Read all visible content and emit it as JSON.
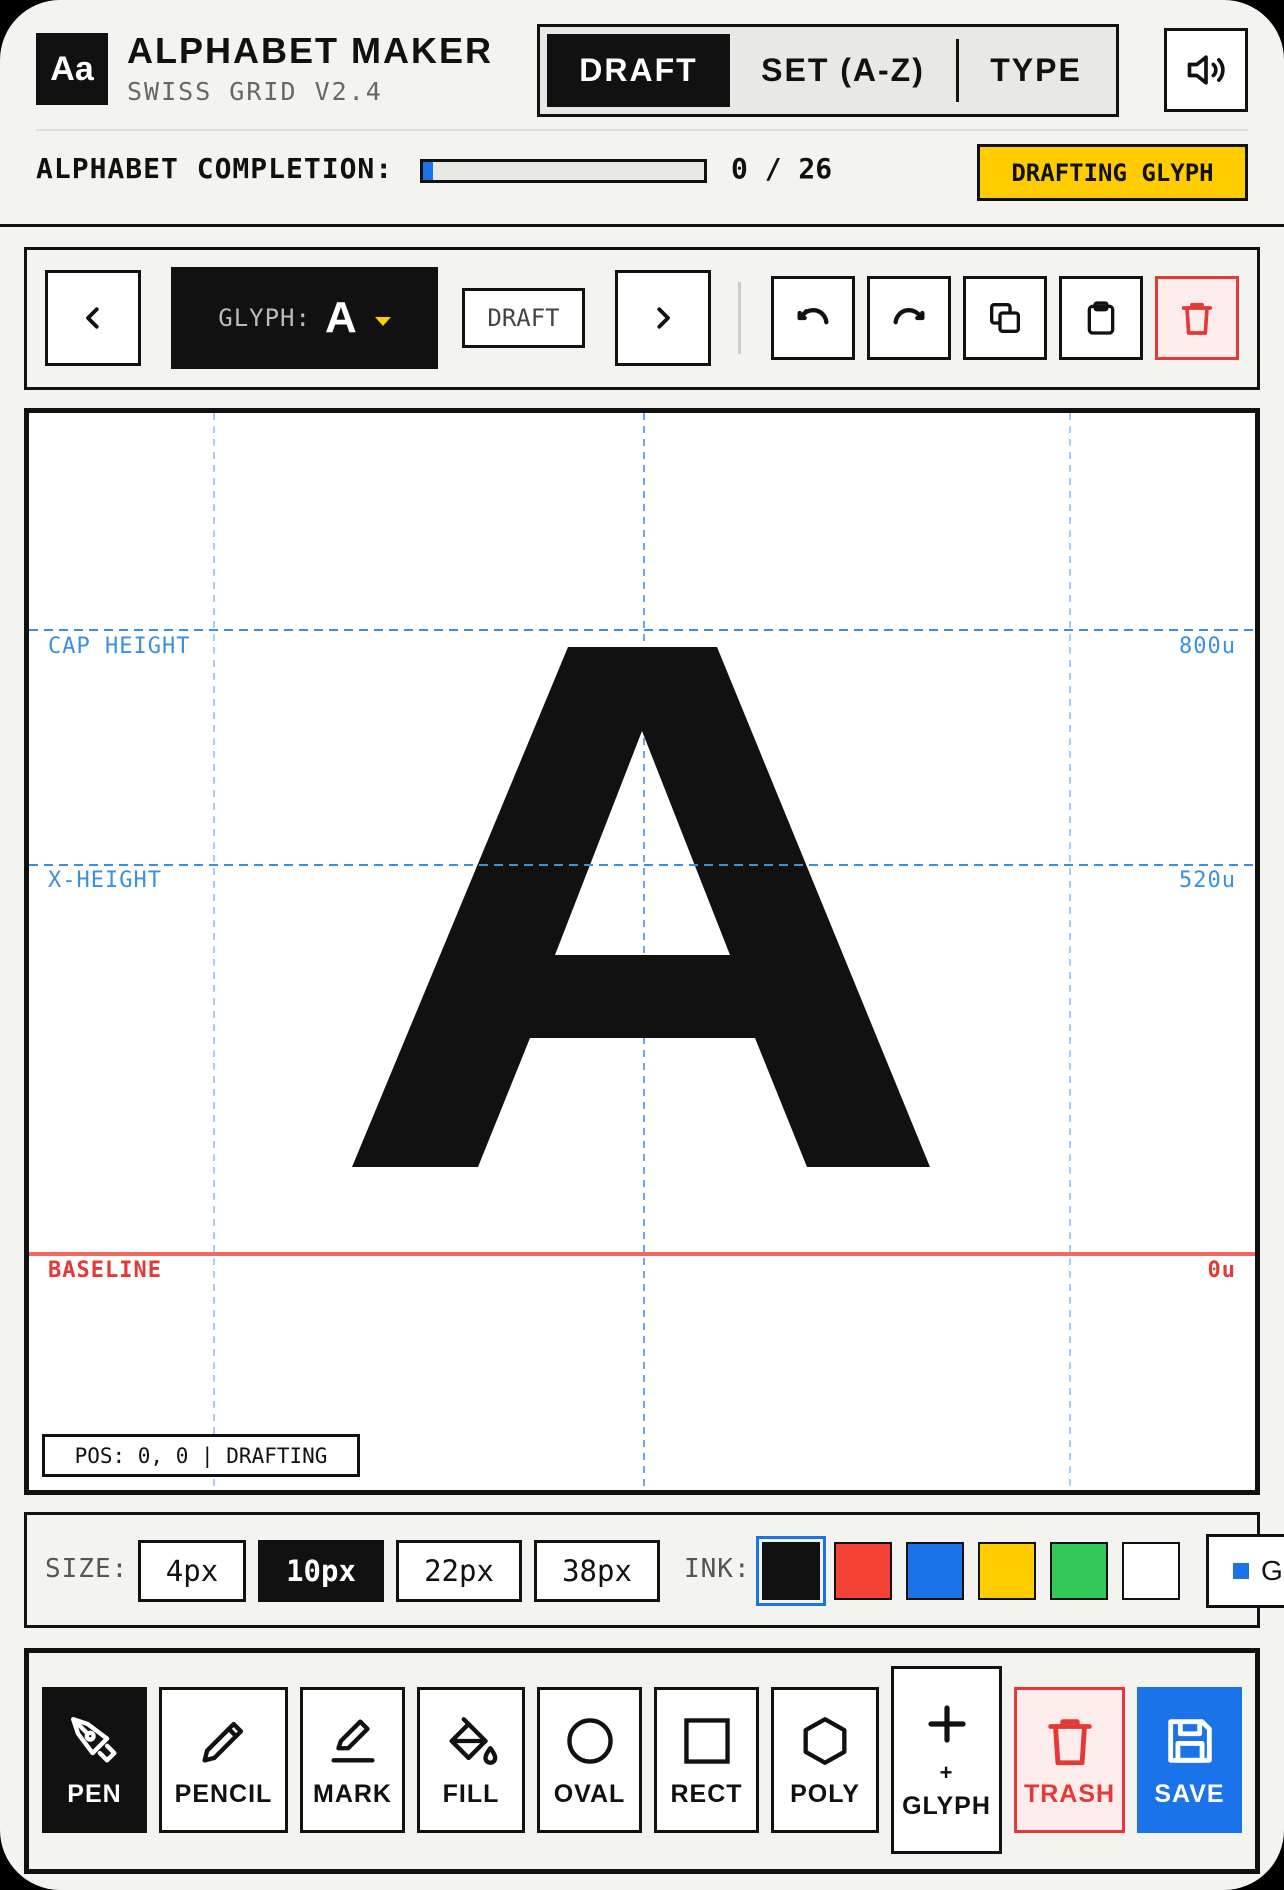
{
  "app": {
    "logo": "Aa",
    "title": "ALPHABET MAKER",
    "subtitle": "SWISS GRID V2.4"
  },
  "modes": {
    "items": [
      "DRAFT",
      "SET (A-Z)",
      "TYPE"
    ],
    "active": "DRAFT"
  },
  "completion": {
    "label": "ALPHABET COMPLETION:",
    "done": 0,
    "total": 26,
    "text": "0 / 26",
    "fraction": 0.0
  },
  "status_badge": "DRAFTING GLYPH",
  "toolbar": {
    "prev_icon": "chevron-left-icon",
    "next_icon": "chevron-right-icon",
    "glyph_label": "GLYPH:",
    "glyph_value": "A",
    "draft_tag": "DRAFT",
    "actions": [
      "undo-icon",
      "redo-icon",
      "copy-icon",
      "clipboard-icon",
      "trash-icon"
    ]
  },
  "canvas": {
    "glyph": "A",
    "guides": {
      "cap_label": "CAP HEIGHT",
      "cap_value": "800u",
      "x_label": "X-HEIGHT",
      "x_value": "520u",
      "base_label": "BASELINE",
      "base_value": "0u"
    },
    "pos_readout": "POS: 0, 0 | DRAFTING"
  },
  "brush": {
    "size_label": "SIZE:",
    "sizes": [
      "4px",
      "10px",
      "22px",
      "38px"
    ],
    "active_size": "10px",
    "ink_label": "INK:",
    "inks": [
      "#111111",
      "#f44336",
      "#1a73e8",
      "#ffcc00",
      "#34c759",
      "#ffffff"
    ],
    "active_ink": "#111111",
    "grid_toggle": "GU"
  },
  "tools": {
    "pen": "PEN",
    "pencil": "PENCIL",
    "mark": "MARK",
    "fill": "FILL",
    "oval": "OVAL",
    "rect": "RECT",
    "poly": "POLY",
    "add_glyph_line1": "+",
    "add_glyph_line2": "GLYPH",
    "trash": "TRASH",
    "save": "SAVE",
    "active": "PEN"
  },
  "colors": {
    "accent": "#1a73e8",
    "warning": "#ffcc00",
    "danger": "#e53935",
    "ink": "#111111"
  }
}
